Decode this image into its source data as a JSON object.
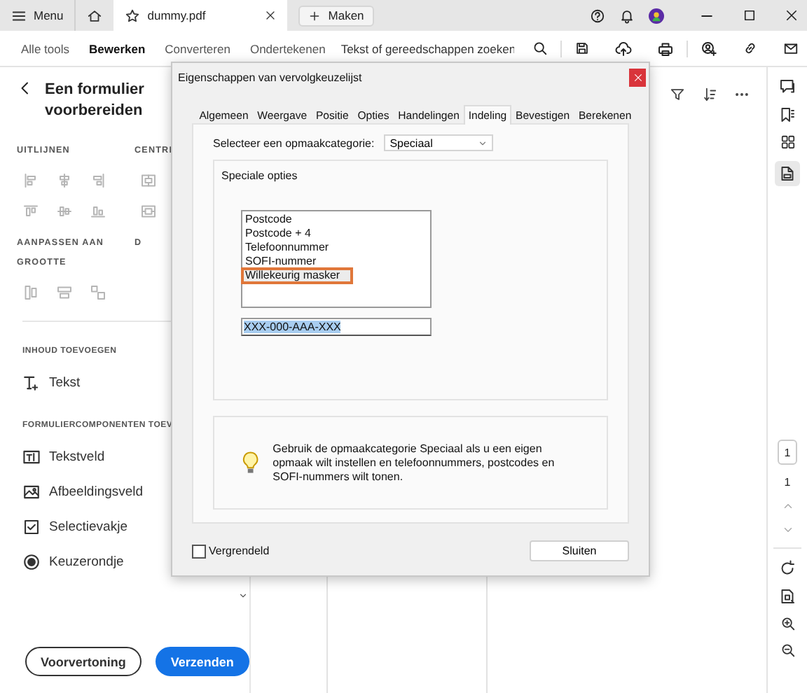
{
  "titlebar": {
    "menu": "Menu",
    "document": "dummy.pdf",
    "new": "Maken"
  },
  "toolbar": {
    "items": [
      {
        "label": "Alle tools",
        "selected": false
      },
      {
        "label": "Bewerken",
        "selected": true
      },
      {
        "label": "Converteren",
        "selected": false
      },
      {
        "label": "Ondertekenen",
        "selected": false
      }
    ],
    "search": {
      "placeholder": "Tekst of gereedschappen zoeken"
    }
  },
  "side_panel": {
    "title": "Een formulier voorbereiden",
    "groups": [
      {
        "kind": "align",
        "heading": "UITLIJNEN"
      },
      {
        "kind": "center",
        "heading": "CENTRI"
      },
      {
        "kind": "resize",
        "heading": "AANPASSEN AAN GROOTTE"
      },
      {
        "kind": "distribute",
        "heading": "D"
      }
    ],
    "sections": [
      {
        "heading": "INHOUD TOEVOEGEN",
        "items": [
          {
            "kind": "text",
            "label": "Tekst"
          }
        ]
      },
      {
        "heading": "FORMULIERCOMPONENTEN TOEV",
        "items": [
          {
            "kind": "textfield",
            "label": "Tekstveld"
          },
          {
            "kind": "image",
            "label": "Afbeeldingsveld"
          },
          {
            "kind": "checkbox",
            "label": "Selectievakje"
          },
          {
            "kind": "radio",
            "label": "Keuzerondje"
          }
        ]
      }
    ],
    "buttons": [
      {
        "kind": "secondary",
        "label": "Voorvertoning"
      },
      {
        "kind": "primary",
        "label": "Verzenden"
      }
    ]
  },
  "page_nav": {
    "current": "1",
    "total": "1"
  },
  "dialog": {
    "title": "Eigenschappen van vervolgkeuzelijst",
    "tabs": [
      {
        "label": "Algemeen",
        "selected": false
      },
      {
        "label": "Weergave",
        "selected": false
      },
      {
        "label": "Positie",
        "selected": false
      },
      {
        "label": "Opties",
        "selected": false
      },
      {
        "label": "Handelingen",
        "selected": false
      },
      {
        "label": "Indeling",
        "selected": true
      },
      {
        "label": "Bevestigen",
        "selected": false
      },
      {
        "label": "Berekenen",
        "selected": false
      }
    ],
    "category_label": "Selecteer een opmaakcategorie:",
    "category_value": "Speciaal",
    "group_title": "Speciale opties",
    "options": [
      {
        "label": "Postcode",
        "selected": false
      },
      {
        "label": "Postcode + 4",
        "selected": false
      },
      {
        "label": "Telefoonnummer",
        "selected": false
      },
      {
        "label": "SOFI-nummer",
        "selected": false
      },
      {
        "label": "Willekeurig masker",
        "selected": true
      }
    ],
    "mask_value": "XXX-000-AAA-XXX",
    "hint": "Gebruik de opmaakcategorie Speciaal als u een eigen opmaak wilt instellen en telefoonnummers, postcodes en SOFI-nummers wilt tonen.",
    "lock": {
      "label": "Vergrendeld",
      "checked": false
    },
    "close_button": "Sluiten"
  }
}
